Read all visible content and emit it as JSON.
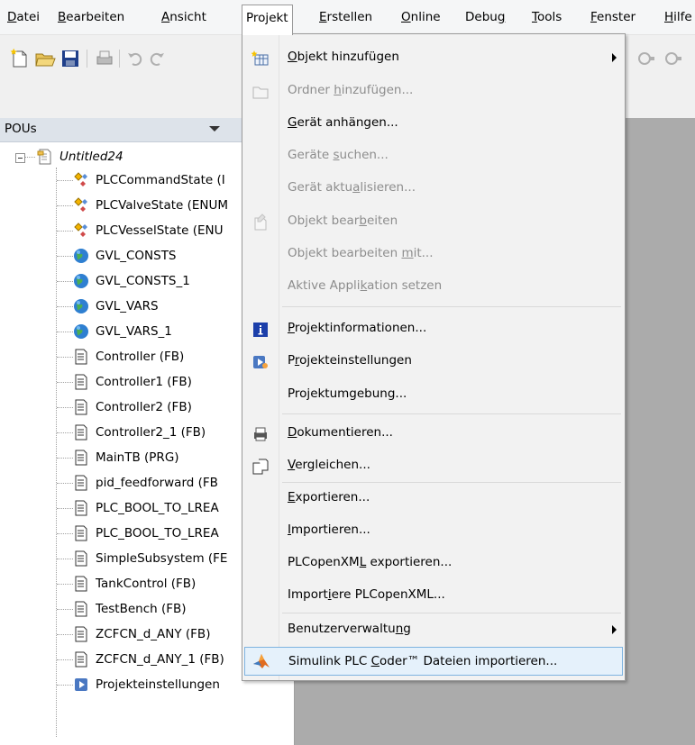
{
  "menubar": {
    "items": [
      {
        "pre": "",
        "ul": "D",
        "post": "atei"
      },
      {
        "pre": "",
        "ul": "B",
        "post": "earbeiten"
      },
      {
        "pre": "",
        "ul": "A",
        "post": "nsicht"
      },
      {
        "pre": "Pro",
        "ul": "j",
        "post": "ekt"
      },
      {
        "pre": "",
        "ul": "E",
        "post": "rstellen"
      },
      {
        "pre": "",
        "ul": "O",
        "post": "nline"
      },
      {
        "pre": "Debu",
        "ul": "g",
        "post": ""
      },
      {
        "pre": "",
        "ul": "T",
        "post": "ools"
      },
      {
        "pre": "",
        "ul": "F",
        "post": "enster"
      },
      {
        "pre": "",
        "ul": "H",
        "post": "ilfe"
      }
    ]
  },
  "pou_panel": {
    "title": "POUs",
    "root": "Untitled24",
    "items": [
      {
        "label": "PLCCommandState (I",
        "icon": "enum-icon"
      },
      {
        "label": "PLCValveState (ENUM",
        "icon": "enum-icon"
      },
      {
        "label": "PLCVesselState (ENU",
        "icon": "enum-icon"
      },
      {
        "label": "GVL_CONSTS",
        "icon": "globe-icon"
      },
      {
        "label": "GVL_CONSTS_1",
        "icon": "globe-icon"
      },
      {
        "label": "GVL_VARS",
        "icon": "globe-icon"
      },
      {
        "label": "GVL_VARS_1",
        "icon": "globe-icon"
      },
      {
        "label": "Controller (FB)",
        "icon": "document-icon"
      },
      {
        "label": "Controller1 (FB)",
        "icon": "document-icon"
      },
      {
        "label": "Controller2 (FB)",
        "icon": "document-icon"
      },
      {
        "label": "Controller2_1 (FB)",
        "icon": "document-icon"
      },
      {
        "label": "MainTB (PRG)",
        "icon": "document-icon"
      },
      {
        "label": "pid_feedforward (FB",
        "icon": "document-icon"
      },
      {
        "label": "PLC_BOOL_TO_LREA",
        "icon": "document-icon"
      },
      {
        "label": "PLC_BOOL_TO_LREA",
        "icon": "document-icon"
      },
      {
        "label": "SimpleSubsystem (FE",
        "icon": "document-icon"
      },
      {
        "label": "TankControl (FB)",
        "icon": "document-icon"
      },
      {
        "label": "TestBench (FB)",
        "icon": "document-icon"
      },
      {
        "label": "ZCFCN_d_ANY (FB)",
        "icon": "document-icon"
      },
      {
        "label": "ZCFCN_d_ANY_1 (FB)",
        "icon": "document-icon"
      },
      {
        "label": "Projekteinstellungen",
        "icon": "project-settings-icon"
      }
    ]
  },
  "projekt_menu": {
    "items": [
      {
        "pre": "",
        "ul": "O",
        "post": "bjekt hinzufügen",
        "enabled": true,
        "icon": "add-object-icon",
        "submenu": true
      },
      {
        "pre": "Ordner ",
        "ul": "h",
        "post": "inzufügen...",
        "enabled": false,
        "icon": "folder-icon"
      },
      {
        "pre": "",
        "ul": "G",
        "post": "erät anhängen...",
        "enabled": true
      },
      {
        "pre": "Geräte ",
        "ul": "s",
        "post": "uchen...",
        "enabled": false
      },
      {
        "pre": "Gerät aktu",
        "ul": "a",
        "post": "lisieren...",
        "enabled": false
      },
      {
        "pre": "Objekt bear",
        "ul": "b",
        "post": "eiten",
        "enabled": false,
        "icon": "edit-object-icon"
      },
      {
        "pre": "Objekt bearbeiten ",
        "ul": "m",
        "post": "it...",
        "enabled": false
      },
      {
        "pre": "Aktive Appli",
        "ul": "k",
        "post": "ation setzen",
        "enabled": false
      },
      {
        "pre": "",
        "ul": "P",
        "post": "rojektinformationen...",
        "enabled": true,
        "icon": "info-icon"
      },
      {
        "pre": "P",
        "ul": "r",
        "post": "ojekteinstellungen",
        "enabled": true,
        "icon": "project-settings-icon"
      },
      {
        "pre": "Pro",
        "ul": "j",
        "post": "ektumgebung...",
        "enabled": true
      },
      {
        "pre": "",
        "ul": "D",
        "post": "okumentieren...",
        "enabled": true,
        "icon": "printer-icon"
      },
      {
        "pre": "",
        "ul": "V",
        "post": "ergleichen...",
        "enabled": true,
        "icon": "compare-icon"
      },
      {
        "pre": "",
        "ul": "E",
        "post": "xportieren...",
        "enabled": true
      },
      {
        "pre": "",
        "ul": "I",
        "post": "mportieren...",
        "enabled": true
      },
      {
        "pre": "PLCopenXM",
        "ul": "L",
        "post": " exportieren...",
        "enabled": true
      },
      {
        "pre": "Import",
        "ul": "i",
        "post": "ere PLCopenXML...",
        "enabled": true
      },
      {
        "pre": "Benutzerverwaltu",
        "ul": "n",
        "post": "g",
        "enabled": true,
        "submenu": true
      },
      {
        "pre": "Simulink PLC ",
        "ul": "C",
        "post": "oder™ Dateien importieren...",
        "enabled": true,
        "icon": "matlab-icon",
        "highlighted": true
      }
    ]
  },
  "colors": {
    "highlight_bg": "#e5f1fb",
    "highlight_border": "#7fb3e0",
    "editor_bg": "#ababab",
    "panel_header": "#dde3ea"
  }
}
